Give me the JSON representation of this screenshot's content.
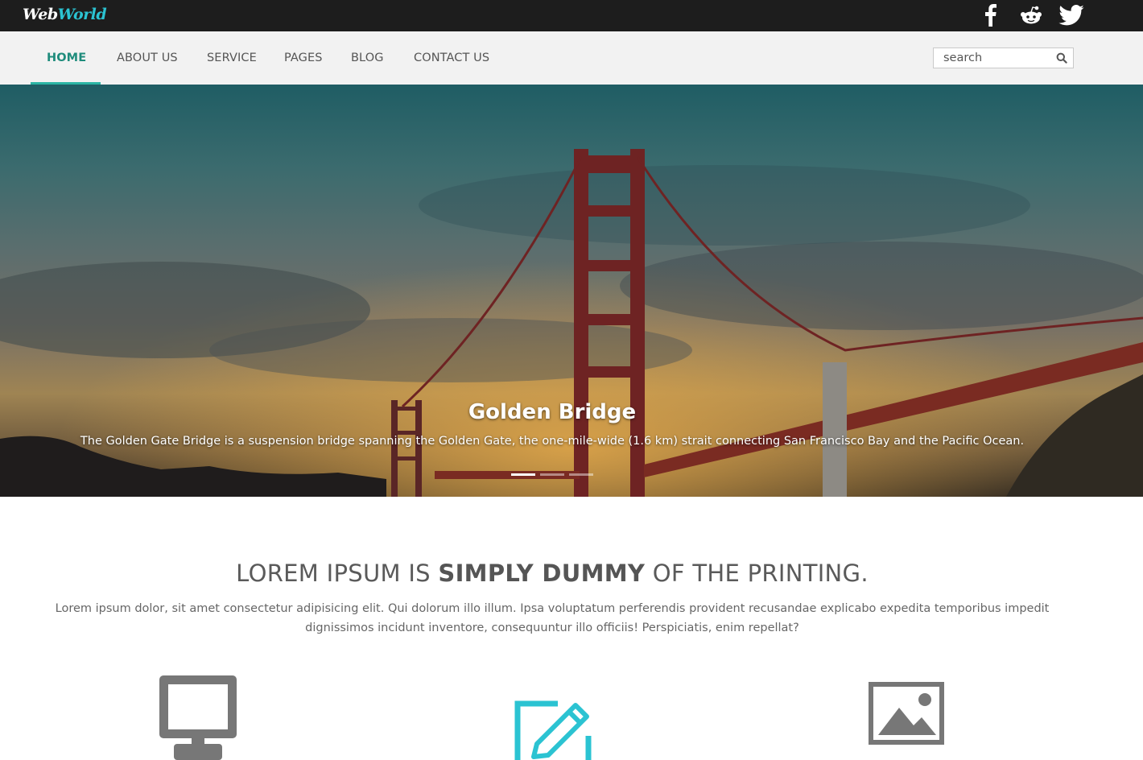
{
  "brand": {
    "logo_part1": "Web",
    "logo_part2": "World",
    "accent": "#2bc3d2"
  },
  "social": [
    {
      "name": "facebook-icon"
    },
    {
      "name": "reddit-icon"
    },
    {
      "name": "twitter-icon"
    }
  ],
  "nav": {
    "items": [
      "HOME",
      "ABOUT US",
      "SERVICE",
      "PAGES",
      "BLOG",
      "CONTACT US"
    ],
    "active_index": 0,
    "active_color": "#1f8c7c"
  },
  "search": {
    "placeholder": "search",
    "value": ""
  },
  "hero": {
    "title": "Golden Bridge",
    "description": "The Golden Gate Bridge is a suspension bridge spanning the Golden Gate, the one-mile-wide (1.6 km) strait connecting San Francisco Bay and the Pacific Ocean.",
    "slides": 3,
    "active_slide": 0
  },
  "intro": {
    "headline_part1": "LOREM IPSUM IS ",
    "headline_bold": "SIMPLY DUMMY",
    "headline_part2": " OF THE PRINTING.",
    "lead": "Lorem ipsum dolor, sit amet consectetur adipisicing elit. Qui dolorum illo illum. Ipsa voluptatum perferendis provident recusandae explicabo expedita temporibus impedit dignissimos incidunt inventore, consequuntur illo officiis! Perspiciatis, enim repellat?"
  },
  "features": [
    {
      "icon": "monitor-icon",
      "color": "#777777"
    },
    {
      "icon": "edit-icon",
      "color": "#2bc3d2"
    },
    {
      "icon": "image-icon",
      "color": "#777777"
    }
  ]
}
